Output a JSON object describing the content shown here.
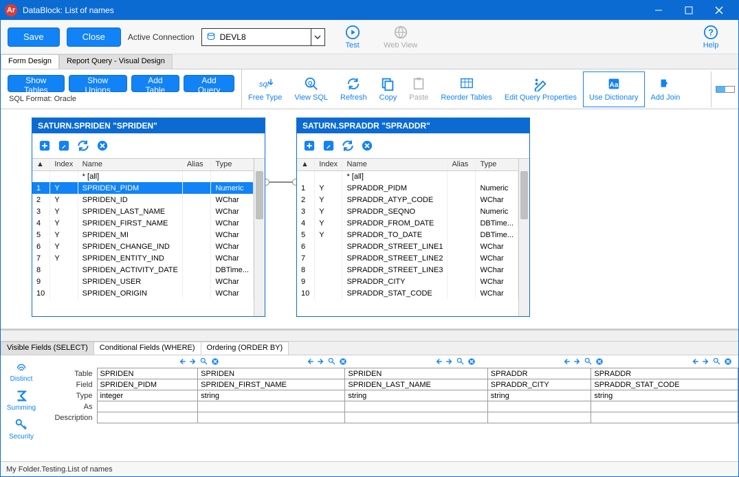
{
  "titlebar": {
    "app_badge": "Ar",
    "title": "DataBlock: List of names"
  },
  "toolbar": {
    "save": "Save",
    "close": "Close",
    "active_conn_label": "Active Connection",
    "connection": "DEVL8",
    "test": "Test",
    "webview": "Web View",
    "help": "Help"
  },
  "tabs": {
    "form": "Form Design",
    "report": "Report Query - Visual Design"
  },
  "actions": {
    "show_tables": "Show Tables",
    "show_unions": "Show Unions",
    "add_table": "Add Table",
    "add_query": "Add Query",
    "sql_format": "SQL Format: Oracle"
  },
  "ribbon": {
    "free_type": "Free Type",
    "view_sql": "View SQL",
    "refresh": "Refresh",
    "copy": "Copy",
    "paste": "Paste",
    "reorder": "Reorder Tables",
    "edit_props": "Edit Query Properties",
    "use_dict": "Use Dictionary",
    "add_join": "Add Join"
  },
  "tables": {
    "left": {
      "title": "SATURN.SPRIDEN \"SPRIDEN\"",
      "all": "* [all]",
      "cols": [
        "",
        "Index",
        "Name",
        "Alias",
        "Type"
      ],
      "rows": [
        {
          "n": "1",
          "idx": "Y",
          "name": "SPRIDEN_PIDM",
          "alias": "",
          "type": "Numeric",
          "sel": true
        },
        {
          "n": "2",
          "idx": "Y",
          "name": "SPRIDEN_ID",
          "alias": "",
          "type": "WChar"
        },
        {
          "n": "3",
          "idx": "Y",
          "name": "SPRIDEN_LAST_NAME",
          "alias": "",
          "type": "WChar"
        },
        {
          "n": "4",
          "idx": "Y",
          "name": "SPRIDEN_FIRST_NAME",
          "alias": "",
          "type": "WChar"
        },
        {
          "n": "5",
          "idx": "Y",
          "name": "SPRIDEN_MI",
          "alias": "",
          "type": "WChar"
        },
        {
          "n": "6",
          "idx": "Y",
          "name": "SPRIDEN_CHANGE_IND",
          "alias": "",
          "type": "WChar"
        },
        {
          "n": "7",
          "idx": "Y",
          "name": "SPRIDEN_ENTITY_IND",
          "alias": "",
          "type": "WChar"
        },
        {
          "n": "8",
          "idx": "",
          "name": "SPRIDEN_ACTIVITY_DATE",
          "alias": "",
          "type": "DBTime..."
        },
        {
          "n": "9",
          "idx": "",
          "name": "SPRIDEN_USER",
          "alias": "",
          "type": "WChar"
        },
        {
          "n": "10",
          "idx": "",
          "name": "SPRIDEN_ORIGIN",
          "alias": "",
          "type": "WChar"
        }
      ]
    },
    "right": {
      "title": "SATURN.SPRADDR \"SPRADDR\"",
      "all": "* [all]",
      "cols": [
        "",
        "Index",
        "Name",
        "Alias",
        "Type"
      ],
      "rows": [
        {
          "n": "1",
          "idx": "Y",
          "name": "SPRADDR_PIDM",
          "alias": "",
          "type": "Numeric"
        },
        {
          "n": "2",
          "idx": "Y",
          "name": "SPRADDR_ATYP_CODE",
          "alias": "",
          "type": "WChar"
        },
        {
          "n": "3",
          "idx": "Y",
          "name": "SPRADDR_SEQNO",
          "alias": "",
          "type": "Numeric"
        },
        {
          "n": "4",
          "idx": "Y",
          "name": "SPRADDR_FROM_DATE",
          "alias": "",
          "type": "DBTime..."
        },
        {
          "n": "5",
          "idx": "Y",
          "name": "SPRADDR_TO_DATE",
          "alias": "",
          "type": "DBTime..."
        },
        {
          "n": "6",
          "idx": "",
          "name": "SPRADDR_STREET_LINE1",
          "alias": "",
          "type": "WChar"
        },
        {
          "n": "7",
          "idx": "",
          "name": "SPRADDR_STREET_LINE2",
          "alias": "",
          "type": "WChar"
        },
        {
          "n": "8",
          "idx": "",
          "name": "SPRADDR_STREET_LINE3",
          "alias": "",
          "type": "WChar"
        },
        {
          "n": "9",
          "idx": "",
          "name": "SPRADDR_CITY",
          "alias": "",
          "type": "WChar"
        },
        {
          "n": "10",
          "idx": "",
          "name": "SPRADDR_STAT_CODE",
          "alias": "",
          "type": "WChar"
        }
      ]
    }
  },
  "bottom_tabs": {
    "visible": "Visible Fields (SELECT)",
    "conditional": "Conditional Fields (WHERE)",
    "ordering": "Ordering (ORDER BY)"
  },
  "side": {
    "distinct": "Distinct",
    "summing": "Summing",
    "security": "Security"
  },
  "field_labels": {
    "table": "Table",
    "field": "Field",
    "type": "Type",
    "as": "As",
    "description": "Description"
  },
  "fields": [
    {
      "table": "SPRIDEN",
      "field": "SPRIDEN_PIDM",
      "type": "integer",
      "as": "",
      "desc": ""
    },
    {
      "table": "SPRIDEN",
      "field": "SPRIDEN_FIRST_NAME",
      "type": "string",
      "as": "",
      "desc": ""
    },
    {
      "table": "SPRIDEN",
      "field": "SPRIDEN_LAST_NAME",
      "type": "string",
      "as": "",
      "desc": ""
    },
    {
      "table": "SPRADDR",
      "field": "SPRADDR_CITY",
      "type": "string",
      "as": "",
      "desc": ""
    },
    {
      "table": "SPRADDR",
      "field": "SPRADDR_STAT_CODE",
      "type": "string",
      "as": "",
      "desc": ""
    }
  ],
  "status": "My Folder.Testing.List of names"
}
